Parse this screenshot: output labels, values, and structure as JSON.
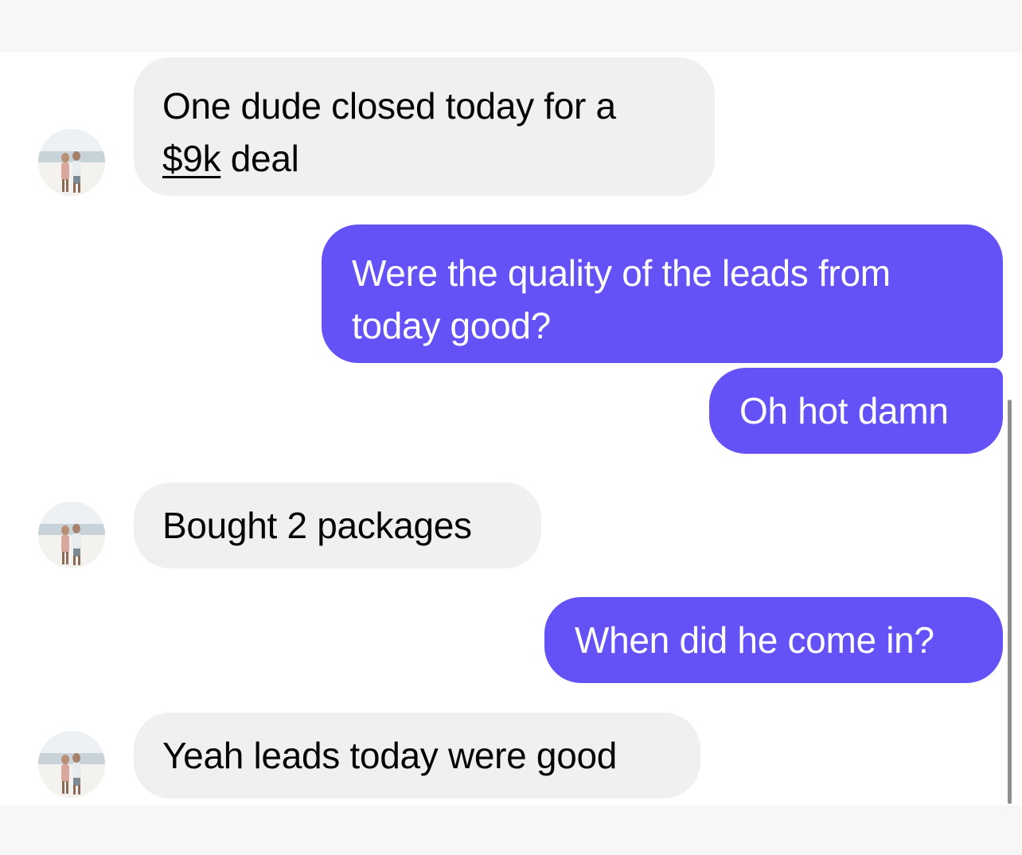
{
  "conversation": {
    "messages": [
      {
        "sender": "other",
        "lines": [
          "One dude closed today for a"
        ],
        "link": "$9k",
        "tail": " deal"
      },
      {
        "sender": "me",
        "lines": [
          "Were the quality of the leads from",
          "today good?"
        ]
      },
      {
        "sender": "me",
        "text": "Oh hot damn"
      },
      {
        "sender": "other",
        "text": "Bought 2 packages"
      },
      {
        "sender": "me",
        "text": "When did he come in?"
      },
      {
        "sender": "other",
        "text": "Yeah leads today were good"
      }
    ]
  },
  "colors": {
    "outgoing_bubble": "#6452f7",
    "incoming_bubble": "#f0f0f0",
    "incoming_text": "#050505",
    "outgoing_text": "#ffffff"
  },
  "icons": {
    "avatar": "contact-avatar-photo"
  }
}
